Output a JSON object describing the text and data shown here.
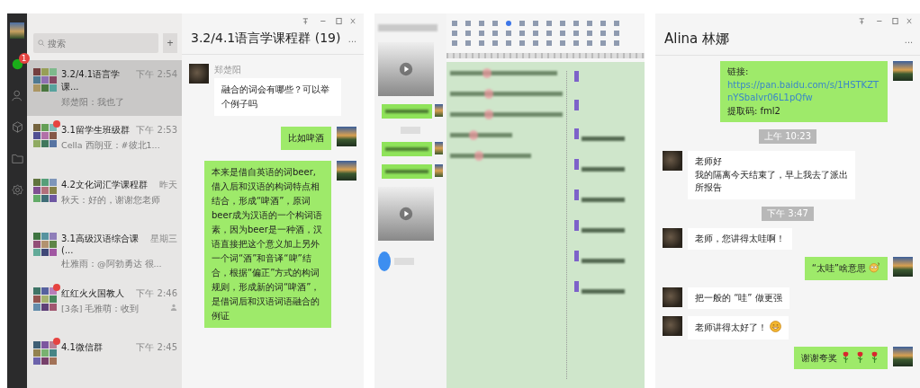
{
  "group_chat_window": {
    "sidebar": {
      "chat_badge": "1"
    },
    "search": {
      "placeholder": "搜索"
    },
    "add_button": "+",
    "conversations": [
      {
        "name": "3.2/4.1语言学课...",
        "time": "下午 2:54",
        "preview": "郑楚阳：我也了",
        "selected": true,
        "unread": false,
        "mention": false
      },
      {
        "name": "3.1留学生班级群",
        "time": "下午 2:53",
        "preview": "Cella 西朗亚：#彼北1...",
        "selected": false,
        "unread": true,
        "mention": false
      },
      {
        "name": "4.2文化词汇学课程群",
        "time": "昨天",
        "preview": "秋天：好的，谢谢您老师",
        "selected": false,
        "unread": false,
        "mention": false
      },
      {
        "name": "3.1高级汉语综合课 (...",
        "time": "星期三",
        "preview": "杜雅雨：@阿勃勇达 很...",
        "selected": false,
        "unread": false,
        "mention": false
      },
      {
        "name": "红红火火国教人",
        "time": "下午 2:46",
        "preview": "[3条] 毛雅萌：收到",
        "selected": false,
        "unread": true,
        "mention": true
      },
      {
        "name": "4.1微信群",
        "time": "下午 2:45",
        "selected": false,
        "unread": true,
        "mention": false
      }
    ],
    "chat": {
      "title": "3.2/4.1语言学课程群 (19)",
      "more": "...",
      "messages": [
        {
          "mine": false,
          "sender": "郑楚阳",
          "text": "融合的词会有哪些？可以举个例子吗"
        },
        {
          "mine": true,
          "text": "比如啤酒"
        },
        {
          "mine": true,
          "text": "本来是借自英语的词beer,借入后和汉语的构词特点相结合，形成“啤酒”，原词beer成为汉语的一个构词语素，因为beer是一种酒，汉语直接把这个意义加上另外一个词“酒”和音译“啤”结合，根据“偏正”方式的构词规则，形成新的词“啤酒”，是借词后和汉语词语融合的例证"
        }
      ]
    }
  },
  "lesson_recording": {
    "messages": [
      {
        "kind": "video"
      },
      {
        "kind": "text"
      },
      {
        "kind": "time"
      },
      {
        "kind": "text"
      },
      {
        "kind": "text"
      },
      {
        "kind": "video"
      }
    ],
    "document_comments": [
      {
        "has_text": false
      },
      {
        "has_text": false
      },
      {
        "has_text": true
      },
      {
        "has_text": true
      },
      {
        "has_text": true
      },
      {
        "has_text": true
      },
      {
        "has_text": true
      },
      {
        "has_text": true
      }
    ]
  },
  "private_chat_window": {
    "title": "Alina 林娜",
    "more": "...",
    "messages": [
      {
        "kind": "link",
        "mine": true,
        "label": "链接:",
        "url": "https://pan.baidu.com/s/1HSTKZTnYSbaIvr06L1pQfw",
        "text": "提取码: fml2"
      },
      {
        "kind": "time",
        "text": "上午 10:23"
      },
      {
        "kind": "text",
        "mine": false,
        "lines": [
          "老师好",
          "我的隔离今天结束了，早上我去了派出所报告"
        ]
      },
      {
        "kind": "time",
        "text": "下午 3:47"
      },
      {
        "kind": "text",
        "mine": false,
        "lines": [
          "老师，您讲得太哇啊！"
        ]
      },
      {
        "kind": "text",
        "mine": true,
        "lines": [
          "“太哇”啥意思"
        ],
        "icons": [
          {
            "kind": "confused"
          }
        ]
      },
      {
        "kind": "text",
        "mine": false,
        "lines": [
          "把一般的 “哇” 做更强"
        ]
      },
      {
        "kind": "text",
        "mine": false,
        "lines": [
          "老师讲得太好了！"
        ],
        "icons": [
          {
            "kind": "smile"
          }
        ]
      },
      {
        "kind": "text",
        "mine": true,
        "lines": [
          "谢谢夸奖"
        ],
        "icons": [
          {
            "kind": "rose"
          },
          {
            "kind": "rose"
          },
          {
            "kind": "rose"
          }
        ]
      }
    ]
  }
}
